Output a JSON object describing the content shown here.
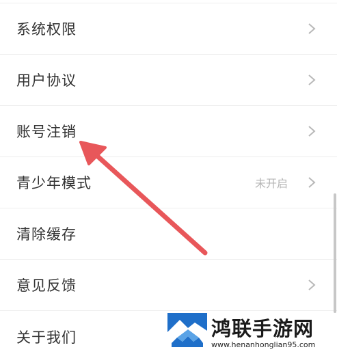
{
  "settings": {
    "items": [
      {
        "label": "系统权限",
        "value": "",
        "chevron": true
      },
      {
        "label": "用户协议",
        "value": "",
        "chevron": true
      },
      {
        "label": "账号注销",
        "value": "",
        "chevron": true
      },
      {
        "label": "青少年模式",
        "value": "未开启",
        "chevron": true
      },
      {
        "label": "清除缓存",
        "value": "",
        "chevron": false
      },
      {
        "label": "意见反馈",
        "value": "",
        "chevron": true
      },
      {
        "label": "关于我们",
        "value": "",
        "chevron": false
      }
    ]
  },
  "annotation": {
    "icon": "red-arrow-icon",
    "color": "#e8575a",
    "target": "账号注销"
  },
  "watermark": {
    "title": "鸿联手游网",
    "url": "www.henanhonglian95.com",
    "icon": "mountain-logo-icon"
  }
}
